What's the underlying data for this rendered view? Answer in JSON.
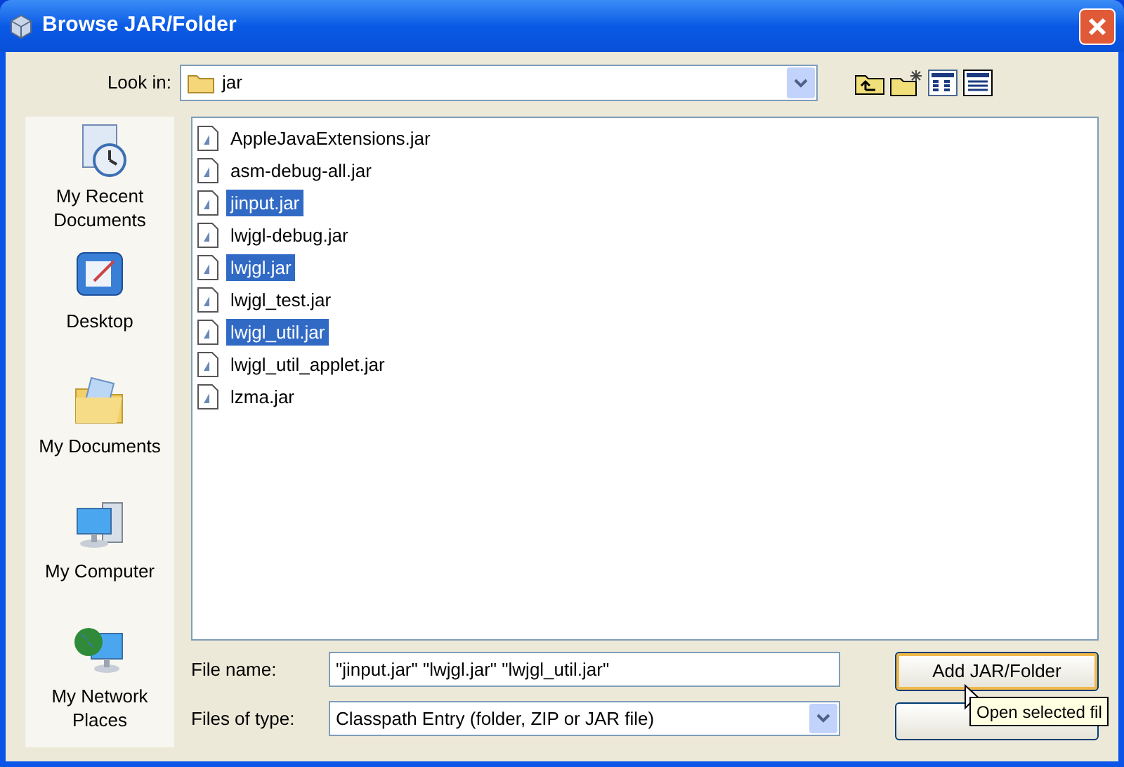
{
  "window": {
    "title": "Browse JAR/Folder"
  },
  "look_in": {
    "label": "Look in:",
    "value": "jar"
  },
  "places": [
    {
      "label": "My Recent Documents",
      "kind": "recent"
    },
    {
      "label": "Desktop",
      "kind": "desktop"
    },
    {
      "label": "My Documents",
      "kind": "documents"
    },
    {
      "label": "My Computer",
      "kind": "computer"
    },
    {
      "label": "My Network Places",
      "kind": "network"
    }
  ],
  "files": [
    {
      "name": "AppleJavaExtensions.jar",
      "selected": false
    },
    {
      "name": "asm-debug-all.jar",
      "selected": false
    },
    {
      "name": "jinput.jar",
      "selected": true
    },
    {
      "name": "lwjgl-debug.jar",
      "selected": false
    },
    {
      "name": "lwjgl.jar",
      "selected": true
    },
    {
      "name": "lwjgl_test.jar",
      "selected": false
    },
    {
      "name": "lwjgl_util.jar",
      "selected": true
    },
    {
      "name": "lwjgl_util_applet.jar",
      "selected": false
    },
    {
      "name": "lzma.jar",
      "selected": false
    }
  ],
  "file_name": {
    "label": "File name:",
    "value": "\"jinput.jar\" \"lwjgl.jar\" \"lwjgl_util.jar\""
  },
  "file_type": {
    "label": "Files of type:",
    "value": "Classpath Entry (folder, ZIP or JAR file)"
  },
  "buttons": [
    {
      "label": "Add JAR/Folder",
      "kind": "default"
    },
    {
      "kind": "cancel"
    }
  ],
  "tooltip": "Open selected fil"
}
